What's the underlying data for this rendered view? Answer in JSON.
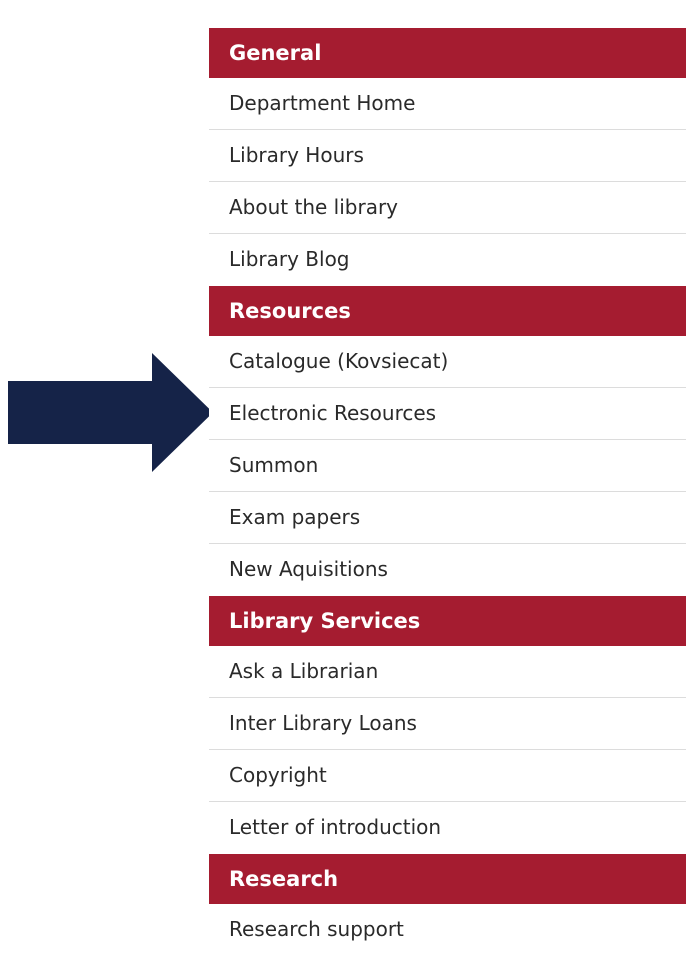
{
  "colors": {
    "header_background": "#a51c30",
    "header_text": "#ffffff",
    "arrow": "#152348"
  },
  "arrow_icon": "right-arrow-icon",
  "sections": [
    {
      "title": "General",
      "items": [
        "Department Home",
        "Library Hours",
        "About the library",
        "Library Blog"
      ]
    },
    {
      "title": "Resources",
      "items": [
        "Catalogue (Kovsiecat)",
        "Electronic Resources",
        "Summon",
        "Exam papers",
        "New Aquisitions"
      ]
    },
    {
      "title": "Library Services",
      "items": [
        "Ask a Librarian",
        "Inter Library Loans",
        "Copyright",
        "Letter of introduction"
      ]
    },
    {
      "title": "Research",
      "items": [
        "Research support"
      ]
    }
  ]
}
